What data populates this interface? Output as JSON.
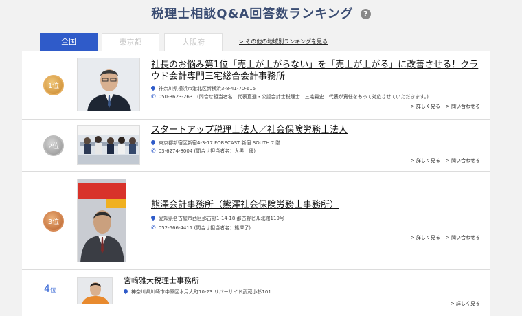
{
  "page": {
    "title": "税理士相談Q&A回答数ランキング",
    "help_icon": "?"
  },
  "tabs": {
    "items": [
      {
        "label": "全国"
      },
      {
        "label": "東京都"
      },
      {
        "label": "大阪府"
      }
    ],
    "other_link": "> その他の地域別ランキングを見る"
  },
  "entries": [
    {
      "rank": "1位",
      "name": "社長のお悩み第1位「売上が上がらない」を「売上が上がる」に改善させる！クラウド会計専門三宅総合会計事務所",
      "address": "神奈川県横浜市港北区新横浜3-8-41-70-615",
      "phone": "050-3623-2631 (問合せ担当者名：代表直通・公認会計士税理士　三宅貴史　代表が責任をもって対応させていただきます。)",
      "details": "> 詳しく見る",
      "contact": "> 問い合わせる"
    },
    {
      "rank": "2位",
      "name": "スタートアップ税理士法人／社会保険労務士法人",
      "address": "東京都新宿区新宿4-3-17 FORECAST 新宿 SOUTH 7 階",
      "phone": "03-6274-8004 (問合せ担当者名：大黒　優)",
      "details": "> 詳しく見る",
      "contact": "> 問い合わせる"
    },
    {
      "rank": "3位",
      "name": "熊澤会計事務所（熊澤社会保険労務士事務所）",
      "address": "愛知県名古屋市西区那古野1-14-18 那古野ビル北館119号",
      "phone": "052-566-4411 (問合せ担当者名：熊澤了)",
      "details": "> 詳しく見る",
      "contact": "> 問い合わせる"
    },
    {
      "rank_num": "4",
      "rank_suffix": "位",
      "name": "宮﨑雅大税理士事務所",
      "address": "神奈川県川崎市中原区木月大町10-23 リバーサイド武蔵小杉101",
      "details": "> 詳しく見る"
    }
  ]
}
